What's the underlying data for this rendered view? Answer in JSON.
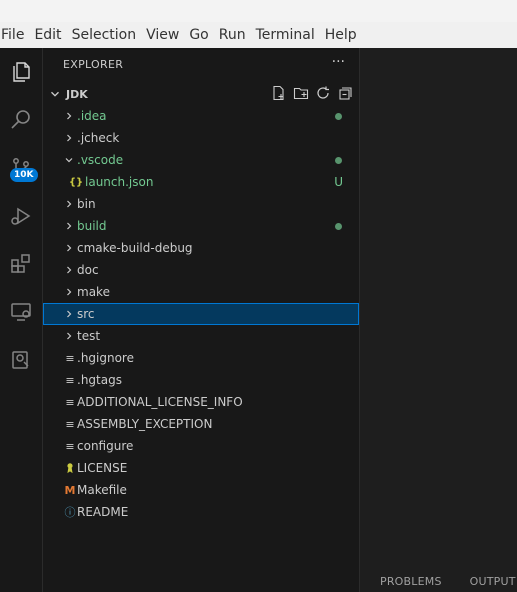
{
  "menubar": {
    "items": [
      "File",
      "Edit",
      "Selection",
      "View",
      "Go",
      "Run",
      "Terminal",
      "Help"
    ]
  },
  "activitybar": {
    "icons": [
      "explorer-icon",
      "search-icon",
      "source-control-icon",
      "run-debug-icon",
      "extensions-icon",
      "remote-explorer-icon",
      "containers-icon"
    ],
    "scm_badge": "10K",
    "badge_color": "#0078d4"
  },
  "sidebar": {
    "header": "EXPLORER",
    "more": "···",
    "root": "JDK",
    "actions": [
      "new-file-icon",
      "new-folder-icon",
      "refresh-icon",
      "collapse-all-icon"
    ],
    "items": [
      {
        "label": ".idea",
        "type": "folder",
        "expanded": false,
        "depth": 0,
        "color": "#73c991",
        "decoration": "dot"
      },
      {
        "label": ".jcheck",
        "type": "folder",
        "expanded": false,
        "depth": 0
      },
      {
        "label": ".vscode",
        "type": "folder",
        "expanded": true,
        "depth": 0,
        "color": "#73c991",
        "decoration": "dot"
      },
      {
        "label": "launch.json",
        "type": "json",
        "depth": 1,
        "color": "#73c991",
        "decoration": "U",
        "icon": "{}"
      },
      {
        "label": "bin",
        "type": "folder",
        "expanded": false,
        "depth": 0
      },
      {
        "label": "build",
        "type": "folder",
        "expanded": false,
        "depth": 0,
        "color": "#73c991",
        "decoration": "dot"
      },
      {
        "label": "cmake-build-debug",
        "type": "folder",
        "expanded": false,
        "depth": 0
      },
      {
        "label": "doc",
        "type": "folder",
        "expanded": false,
        "depth": 0
      },
      {
        "label": "make",
        "type": "folder",
        "expanded": false,
        "depth": 0
      },
      {
        "label": "src",
        "type": "folder",
        "expanded": false,
        "depth": 0,
        "selected": true
      },
      {
        "label": "test",
        "type": "folder",
        "expanded": false,
        "depth": 0
      },
      {
        "label": ".hgignore",
        "type": "text",
        "depth": 0,
        "icon": "≡"
      },
      {
        "label": ".hgtags",
        "type": "text",
        "depth": 0,
        "icon": "≡"
      },
      {
        "label": "ADDITIONAL_LICENSE_INFO",
        "type": "text",
        "depth": 0,
        "icon": "≡"
      },
      {
        "label": "ASSEMBLY_EXCEPTION",
        "type": "text",
        "depth": 0,
        "icon": "≡"
      },
      {
        "label": "configure",
        "type": "text",
        "depth": 0,
        "icon": "≡"
      },
      {
        "label": "LICENSE",
        "type": "license",
        "depth": 0,
        "icon": "license-icon"
      },
      {
        "label": "Makefile",
        "type": "makefile",
        "depth": 0,
        "icon": "M"
      },
      {
        "label": "README",
        "type": "readme",
        "depth": 0,
        "icon": "ⓘ"
      }
    ]
  },
  "panel": {
    "tabs": [
      "PROBLEMS",
      "OUTPUT"
    ]
  },
  "colors": {
    "accent": "#0078d4",
    "git_added": "#73c991",
    "selected_bg": "#04395e",
    "makefile_icon": "#e37933",
    "readme_icon": "#519aba",
    "json_icon": "#cbcb41",
    "license_icon": "#cbcb41"
  }
}
